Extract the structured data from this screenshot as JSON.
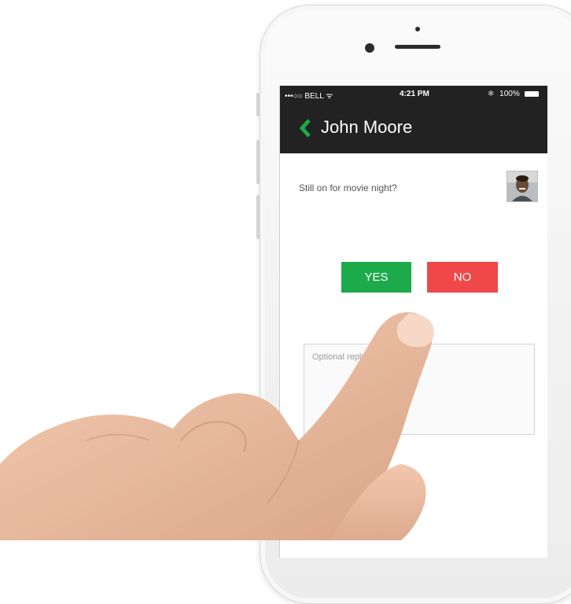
{
  "status_bar": {
    "carrier": "•••○○ BELL ᯤ",
    "time": "4:21 PM",
    "battery": "100%"
  },
  "nav": {
    "back_icon": "chevron-left-icon",
    "title": "John Moore"
  },
  "message": {
    "text": "Still on for movie night?",
    "avatar": "user-avatar-photo"
  },
  "actions": {
    "yes_label": "YES",
    "no_label": "NO"
  },
  "reply": {
    "placeholder": "Optional reply"
  },
  "colors": {
    "yes": "#1caa4a",
    "no": "#f04848",
    "nav_bg": "#222222",
    "accent": "#1caa4a"
  }
}
